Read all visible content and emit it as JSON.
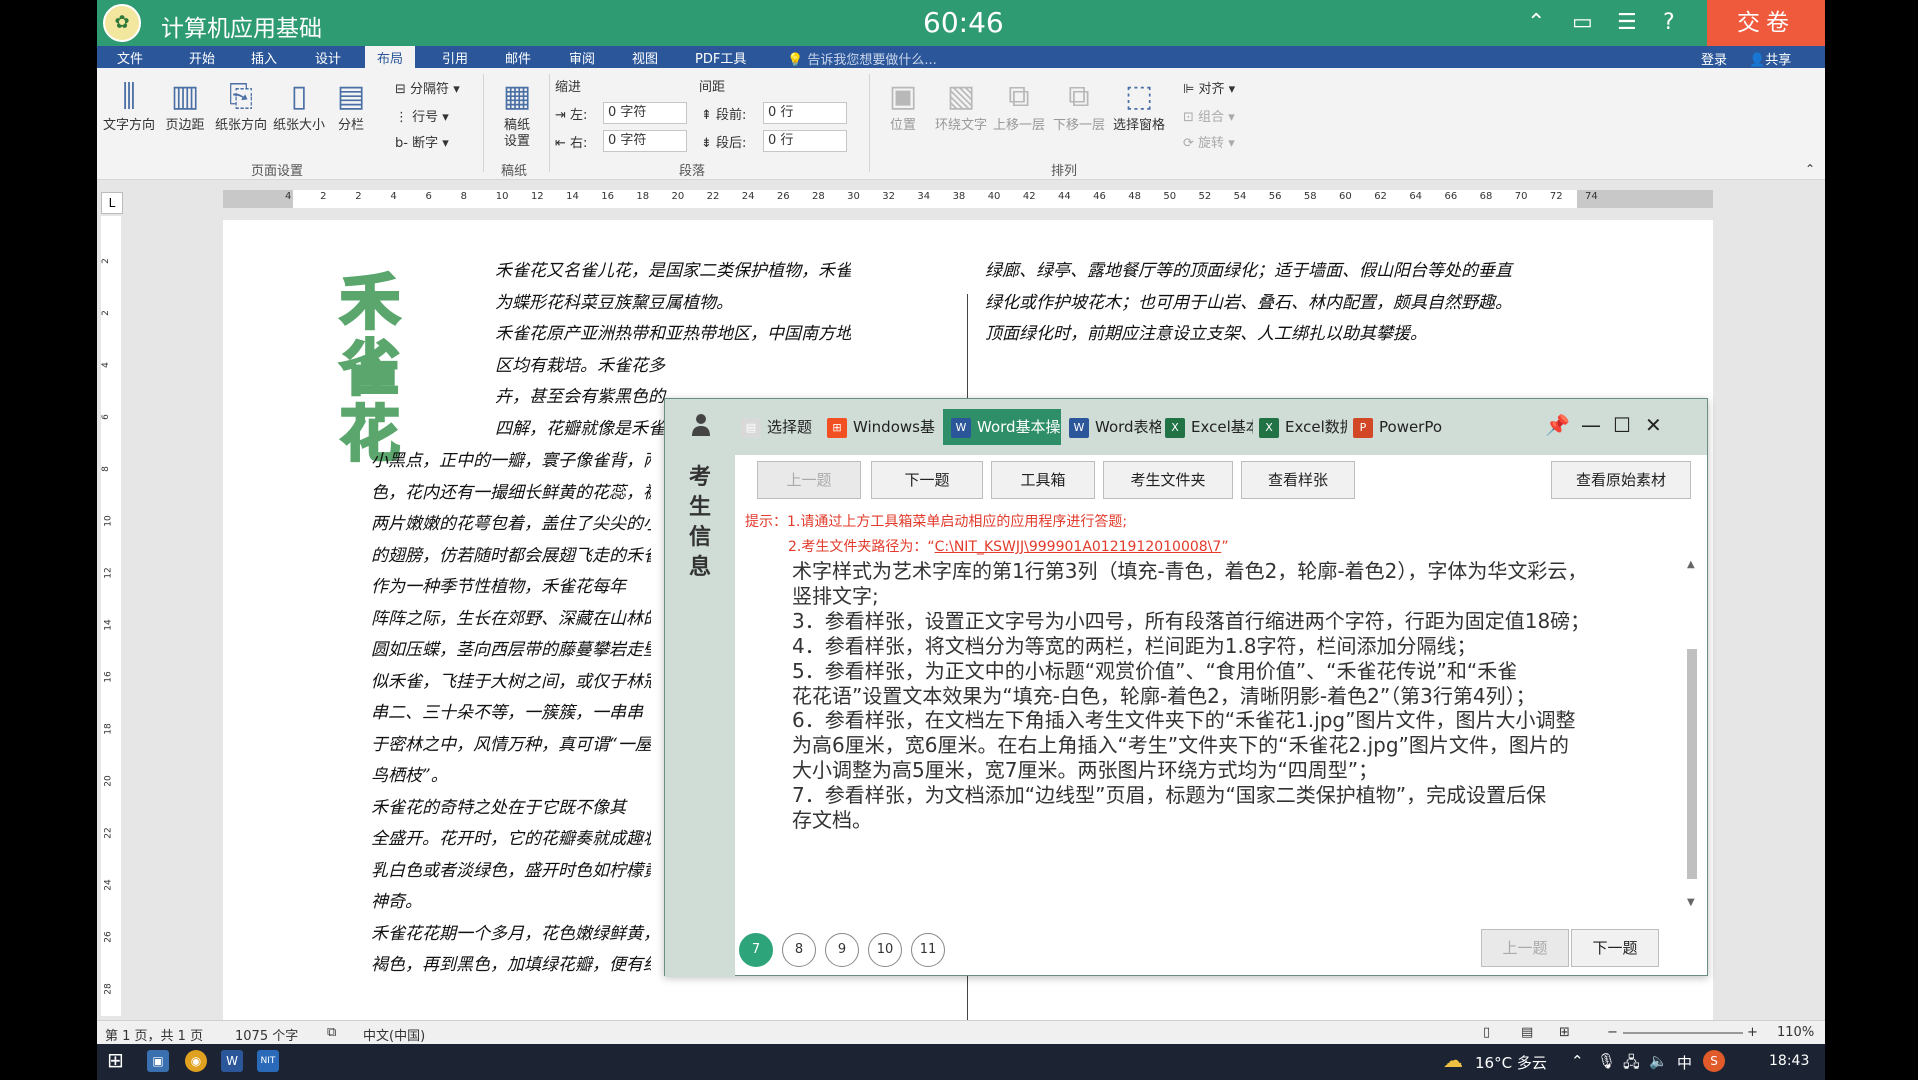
{
  "exam": {
    "app_title": "计算机应用基础",
    "timer": "60:46",
    "submit_label": "交卷"
  },
  "ribbon": {
    "tabs": [
      "文件",
      "开始",
      "插入",
      "设计",
      "布局",
      "引用",
      "邮件",
      "审阅",
      "视图",
      "PDF工具"
    ],
    "active_tab": "布局",
    "tell_me": "告诉我您想要做什么...",
    "login": "登录",
    "share": "共享",
    "page_setup": {
      "text_direction": "文字方向",
      "margins": "页边距",
      "orientation": "纸张方向",
      "size": "纸张大小",
      "columns": "分栏",
      "breaks": "分隔符",
      "line_numbers": "行号",
      "hyphenation": "断字",
      "group_label": "页面设置"
    },
    "draft": {
      "label": "稿纸\n设置",
      "group_label": "稿纸"
    },
    "paragraph": {
      "indent_label": "缩进",
      "spacing_label": "间距",
      "left_label": "左:",
      "left_value": "0 字符",
      "right_label": "右:",
      "right_value": "0 字符",
      "before_label": "段前:",
      "before_value": "0 行",
      "after_label": "段后:",
      "after_value": "0 行",
      "group_label": "段落"
    },
    "arrange": {
      "position": "位置",
      "wrap_text": "环绕文字",
      "bring_forward": "上移一层",
      "send_backward": "下移一层",
      "selection_pane": "选择窗格",
      "align": "对齐",
      "group": "组合",
      "rotate": "旋转",
      "group_label": "排列"
    }
  },
  "ruler": {
    "tab_marker": "L",
    "marks": [
      "4",
      "2",
      "2",
      "4",
      "6",
      "8",
      "10",
      "12",
      "14",
      "16",
      "18",
      "20",
      "22",
      "24",
      "26",
      "28",
      "30",
      "32",
      "34",
      "38",
      "40",
      "42",
      "44",
      "46",
      "48",
      "50",
      "52",
      "54",
      "56",
      "58",
      "60",
      "62",
      "64",
      "66",
      "68",
      "70",
      "72",
      "74"
    ],
    "vmarks": [
      "2",
      "2",
      "4",
      "6",
      "8",
      "10",
      "12",
      "14",
      "16",
      "18",
      "20",
      "22",
      "24",
      "26",
      "28"
    ]
  },
  "document": {
    "art_title": [
      "禾",
      "雀",
      "花"
    ],
    "left_top": [
      "禾雀花又名雀儿花，是国家二类保护植物，禾雀花",
      "为蝶形花科菜豆族黧豆属植物。",
      "禾雀花原产亚洲热带和亚热带地区，中国南方地",
      "区均有栽培。禾雀花多",
      "卉，甚至会有紫黑色的",
      "四解，花瓣就像是禾雀"
    ],
    "left_body": [
      "小黑点，正中的一瓣，寰子像雀背，两",
      "色，花内还有一撮细长鲜黄的花蕊，被",
      "两片嫩嫩的花萼包着，盖住了尖尖的小",
      "的翅膀，仿若随时都会展翅飞走的禾雀",
      "作为一种季节性植物，禾雀花每年",
      "阵阵之际，生长在郊野、深藏在山林的",
      "圆如压蝶，茎向西层带的藤蔓攀岩走壁",
      "似禾雀，飞挂于大树之间，或仅于林冠",
      "串二、三十朵不等，一簇簇，一串串",
      "于密林之中，风情万种，真可谓“一屋",
      "鸟栖枝”。",
      "禾雀花的奇特之处在于它既不像其",
      "全盛开。花开时，它的花瓣奏就成趣状",
      "乳白色或者淡绿色，盛开时色如柠檬黄",
      "神奇。",
      "禾雀花花期一个多月，花色嫩绿鲜黄，摘下二、三个小时后逐变为",
      "褐色，再到黑色，加填绿花瓣，便有红色汁液流出来，就象受伤的禾雀"
    ],
    "right_top": [
      "绿廊、绿亭、露地餐厅等的顶面绿化；适于墙面、假山阳台等处的垂直",
      "绿化或作护坡花木；也可用于山岩、叠石、林内配置，颇具自然野趣。",
      "顶面绿化时，前期应注意设立支架、人工绑扎以助其攀援。"
    ]
  },
  "statusbar": {
    "page": "第 1 页，共 1 页",
    "words": "1075 个字",
    "language": "中文(中国)",
    "zoom": "110%"
  },
  "taskbar": {
    "weather": "16°C 多云",
    "ime": "中",
    "time": "18:43"
  },
  "exam_panel": {
    "side_label": [
      "考",
      "生",
      "信",
      "息"
    ],
    "tabs": [
      {
        "label": "选择题",
        "color": "#d9d9d9",
        "icon": "choice-icon"
      },
      {
        "label": "Windows基",
        "color": "#f25022",
        "icon": "windows-icon"
      },
      {
        "label": "Word基本操作",
        "color": "#2b579a",
        "icon": "word-icon"
      },
      {
        "label": "Word表格",
        "color": "#2b579a",
        "icon": "word-icon"
      },
      {
        "label": "Excel基本",
        "color": "#217346",
        "icon": "excel-icon"
      },
      {
        "label": "Excel数据",
        "color": "#217346",
        "icon": "excel-icon"
      },
      {
        "label": "PowerPoi",
        "color": "#d24726",
        "icon": "ppt-icon"
      }
    ],
    "active_tab": "Word基本操作",
    "buttons": {
      "prev": "上一题",
      "next": "下一题",
      "toolbox": "工具箱",
      "folder": "考生文件夹",
      "sample": "查看样张",
      "original": "查看原始素材"
    },
    "hint_label": "提示：",
    "hint1": "1.请通过上方工具箱菜单启动相应的应用程序进行答题;",
    "hint2_prefix": "2.考生文件夹路径为：“",
    "hint2_path": "C:\\NIT_KSWJJ\\999901A0121912010008\\7",
    "hint2_suffix": "”",
    "question_lines": [
      "术字样式为艺术字库的第1行第3列（填充-青色，着色2，轮廓-着色2），字体为华文彩云，",
      "竖排文字;",
      "3．参看样张，设置正文字号为小四号，所有段落首行缩进两个字符，行距为固定值18磅；",
      "4．参看样张，将文档分为等宽的两栏，栏间距为1.8字符，栏间添加分隔线；",
      "5．参看样张，为正文中的小标题“观赏价值”、“食用价值”、“禾雀花传说”和“禾雀",
      "花花语”设置文本效果为“填充-白色，轮廓-着色2，清晰阴影-着色2”（第3行第4列）；",
      "6．参看样张，在文档左下角插入考生文件夹下的“禾雀花1.jpg”图片文件，图片大小调整",
      "为高6厘米，宽6厘米。在右上角插入“考生”文件夹下的“禾雀花2.jpg”图片文件，图片的",
      "大小调整为高5厘米，宽7厘米。两张图片环绕方式均为“四周型”；",
      "7．参看样张，为文档添加“边线型”页眉，标题为“国家二类保护植物”，完成设置后保",
      "存文档。"
    ],
    "nav": [
      "7",
      "8",
      "9",
      "10",
      "11"
    ],
    "current_nav": "7",
    "bottom_prev": "上一题",
    "bottom_next": "下一题"
  }
}
